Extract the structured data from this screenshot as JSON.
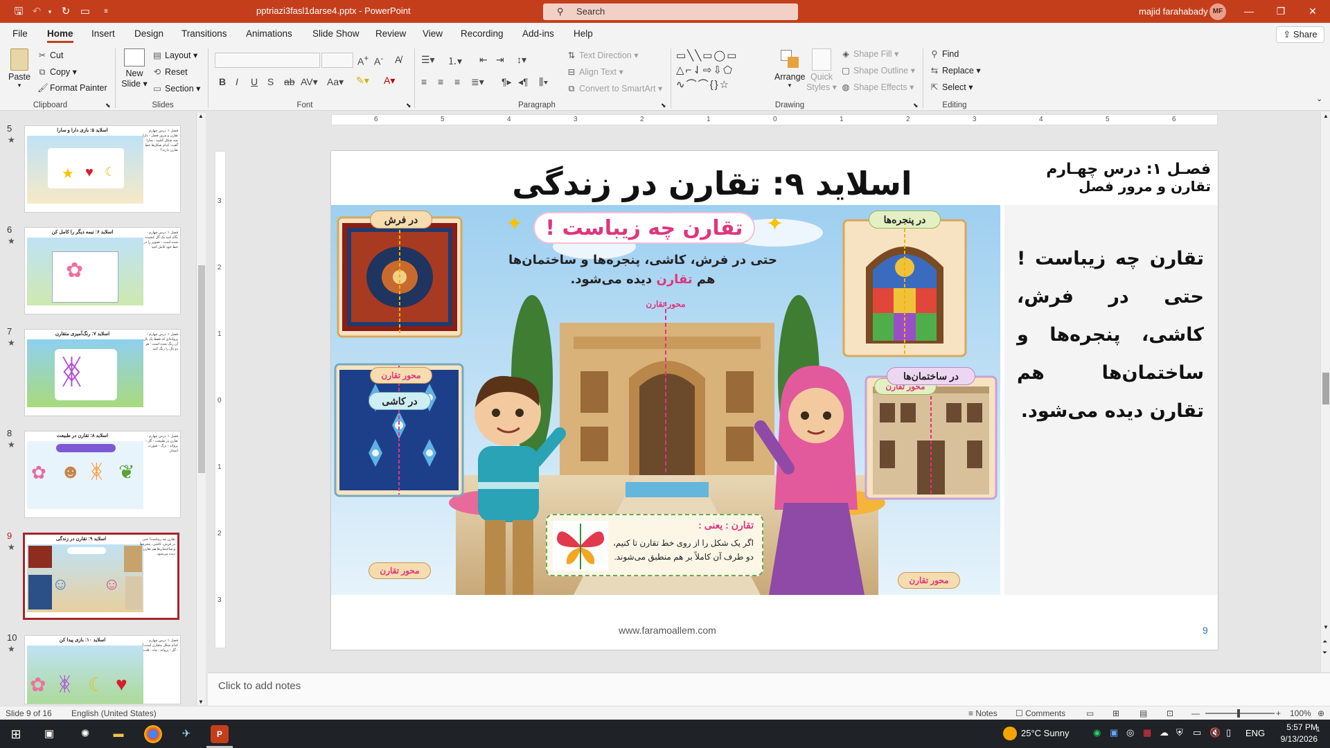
{
  "window": {
    "filename": "pptriazi3fasl1darse4.pptx",
    "app": "PowerPoint",
    "search_placeholder": "Search",
    "user_name": "majid farahabady",
    "user_initials": "MF",
    "share_label": "Share"
  },
  "menu_tabs": [
    "File",
    "Home",
    "Insert",
    "Design",
    "Transitions",
    "Animations",
    "Slide Show",
    "Review",
    "View",
    "Recording",
    "Add-ins",
    "Help"
  ],
  "ribbon": {
    "clipboard": {
      "label": "Clipboard",
      "paste": "Paste",
      "cut": "Cut",
      "copy": "Copy",
      "format_painter": "Format Painter"
    },
    "slides": {
      "label": "Slides",
      "new_slide_1": "New",
      "new_slide_2": "Slide",
      "layout": "Layout",
      "reset": "Reset",
      "section": "Section"
    },
    "font": {
      "label": "Font"
    },
    "paragraph": {
      "label": "Paragraph",
      "text_direction": "Text Direction",
      "align_text": "Align Text",
      "convert_smartart": "Convert to SmartArt"
    },
    "drawing": {
      "label": "Drawing",
      "arrange": "Arrange",
      "quick_styles_1": "Quick",
      "quick_styles_2": "Styles",
      "shape_fill": "Shape Fill",
      "shape_outline": "Shape Outline",
      "shape_effects": "Shape Effects"
    },
    "editing": {
      "label": "Editing",
      "find": "Find",
      "replace": "Replace",
      "select": "Select"
    }
  },
  "thumbnails": [
    {
      "num": "5",
      "title": "اسلاید ۵: بازی دارا و سارا",
      "side": "فصل ۱: درس چهارم تقارن و مرور فصل - دارا چند شکل کشید - سارا گفت: کدام شکل‌ها خط تقارن دارند؟"
    },
    {
      "num": "6",
      "title": "اسلاید ۶: نیمه دیگر را کامل کن",
      "side": "فصل ۱: درس چهارم - نگاه کنید یک گل کشیده شده است - تصویر را در خط خود کامل کنید"
    },
    {
      "num": "7",
      "title": "اسلاید ۷: رنگ‌آمیزی متقارن",
      "side": "فصل ۱: درس چهارم - پروانه‌ای که فقط یک بال آن رنگ شده است - هر دو بال را رنگ کنید"
    },
    {
      "num": "8",
      "title": "اسلاید ۸: تقارن در طبیعت",
      "side": "فصل ۱: درس چهارم - تقارن در طبیعت - گل - پروانه - برگ - صورت انسان"
    },
    {
      "num": "9",
      "title": "اسلاید ۹: تقارن در زندگی",
      "side": "تقارن چه زیباست! حتی در فرش، کاشی، پنجره‌ها و ساختمان‌ها هم تقارن دیده می‌شود."
    },
    {
      "num": "10",
      "title": "اسلاید ۱۰: بازی پیدا کن",
      "side": "فصل ۱: درس چهارم - کدام شکل متقارن است؟ - گل - پروانه - ماه - قلب"
    }
  ],
  "slide": {
    "title": "اسلاید ۹: تقارن در زندگی",
    "chapter_line1": "فصـل ۱: درس چهـارم",
    "chapter_line2": "تقارن و مرور فصل",
    "side_text": "تقارن چه زیباست ! حتی در فرش، کاشی، پنجره‌ها و ساختمان‌ها هم تقارن دیده می‌شود.",
    "footer": "www.faramoallem.com",
    "number": "9",
    "illustration": {
      "banner": "تقارن چه زیباست !",
      "subline1": "حتی در فرش، کاشی، پنجره‌ها و ساختمان‌ها",
      "subline2_a": "هم ",
      "subline2_b": "تقارن",
      "subline2_c": " دیده می‌شود.",
      "carpet_label": "در فرش",
      "tile_label": "در کاشی",
      "window_label": "در پنجره‌ها",
      "building_label": "در ساختمان‌ها",
      "axis_label": "محور تقارن",
      "def_title": "تقارن : یعنی :",
      "def_line1": "اگر یک شکل را از روی خط تقارن تا کنیم،",
      "def_line2": "دو طرف آن کاملاً بر هم منطبق می‌شوند."
    }
  },
  "notes_placeholder": "Click to add notes",
  "status": {
    "slide_info": "Slide 9 of 16",
    "language": "English (United States)",
    "notes": "Notes",
    "comments": "Comments",
    "zoom": "100%"
  },
  "taskbar": {
    "weather": "25°C  Sunny",
    "lang": "ENG",
    "time": "5:57 PM",
    "date": "9/13/2026",
    "notif_count": "1"
  },
  "colors": {
    "accent": "#c43e1c",
    "selected_thumb": "#a4262c"
  }
}
